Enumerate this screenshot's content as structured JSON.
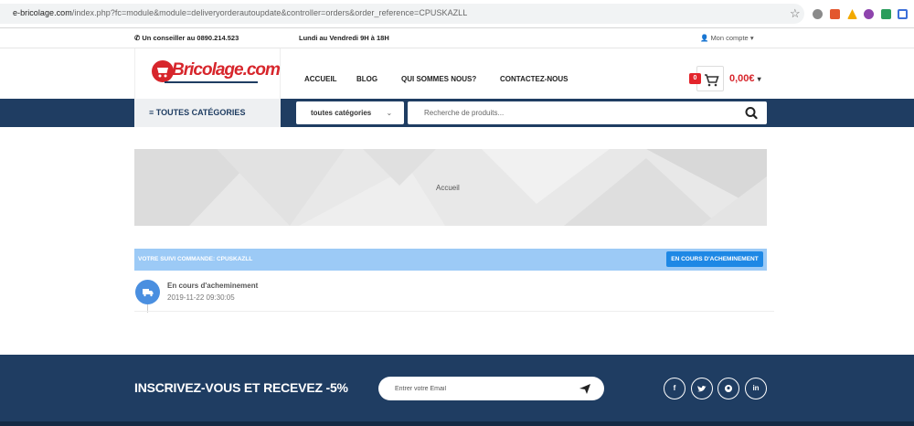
{
  "browser": {
    "url_host": "e-bricolage.com",
    "url_path": "/index.php?fc=module&module=deliveryorderautoupdate&controller=orders&order_reference=CPUSKAZLL"
  },
  "topbar": {
    "phone_text": "Un conseiller au 0890.214.523",
    "hours_text": "Lundi au Vendredi 9H à 18H",
    "account_label": "Mon compte"
  },
  "header": {
    "logo_text": "Bricolage.com",
    "nav": [
      "ACCUEIL",
      "BLOG",
      "QUI SOMMES NOUS?",
      "CONTACTEZ-NOUS"
    ],
    "cart_count": "0",
    "cart_total": "0,00€"
  },
  "categories": {
    "all_label": "TOUTES CATÉGORIES",
    "select_value": "toutes catégories",
    "search_placeholder": "Recherche de produits..."
  },
  "hero": {
    "breadcrumb": "Accueil"
  },
  "tracking": {
    "title": "VOTRE SUIVI COMMANDE: CPUSKAZLL",
    "status_badge": "EN COURS D'ACHEMINEMENT",
    "event_title": "En cours d'acheminement",
    "event_date": "2019-11-22 09:30:05"
  },
  "newsletter": {
    "title": "INSCRIVEZ-VOUS ET RECEVEZ -5%",
    "placeholder": "Entrer votre Email"
  },
  "social": [
    "f",
    "twitter",
    "pinterest",
    "in"
  ],
  "colors": {
    "brand_red": "#d7262c",
    "navy": "#1f3d62",
    "tracking_head": "#9ccaf6",
    "status_blue": "#1e88e5"
  }
}
